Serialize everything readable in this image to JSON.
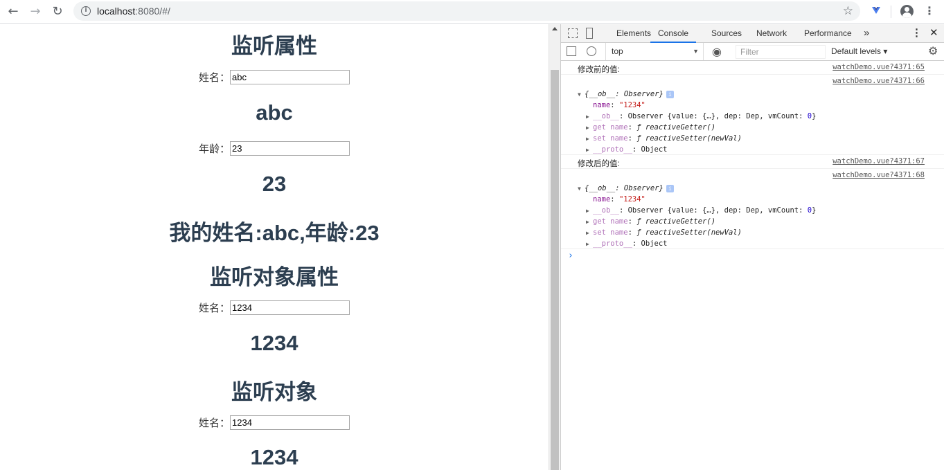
{
  "browser": {
    "url_host": "localhost",
    "url_path": ":8080/#/"
  },
  "page": {
    "sections": [
      {
        "heading": "监听属性"
      },
      {
        "heading": "监听对象属性"
      },
      {
        "heading": "监听对象"
      }
    ],
    "name_label": "姓名：",
    "age_label": "年龄：",
    "name_value": "abc",
    "name_display": "abc",
    "age_value": "23",
    "age_display": "23",
    "summary": "我的姓名:abc,年龄:23",
    "obj_prop_name_value": "1234",
    "obj_prop_display": "1234",
    "obj_name_value": "1234",
    "obj_display": "1234"
  },
  "devtools": {
    "tabs": [
      "Elements",
      "Console",
      "Sources",
      "Network",
      "Performance"
    ],
    "active_tab": "Console",
    "more": "»",
    "context": "top",
    "filter_placeholder": "Filter",
    "levels": "Default levels ▾",
    "messages": [
      {
        "text": "修改前的值:",
        "source": "watchDemo.vue?4371:65"
      },
      {
        "source": "watchDemo.vue?4371:66"
      },
      {
        "text": "修改后的值:",
        "source": "watchDemo.vue?4371:67"
      },
      {
        "source": "watchDemo.vue?4371:68"
      }
    ],
    "object": {
      "header": "{__ob__: Observer}",
      "name_key": "name",
      "name_val": "\"1234\"",
      "ob_key": "__ob__",
      "ob_val": ": Observer {value: {…}, dep: Dep, vmCount: ",
      "ob_count": "0",
      "ob_end": "}",
      "get_key": "get name",
      "get_val": "ƒ reactiveGetter()",
      "set_key": "set name",
      "set_val": "ƒ reactiveSetter(newVal)",
      "proto_key": "__proto__",
      "proto_val": ": Object"
    },
    "prompt": "›"
  }
}
